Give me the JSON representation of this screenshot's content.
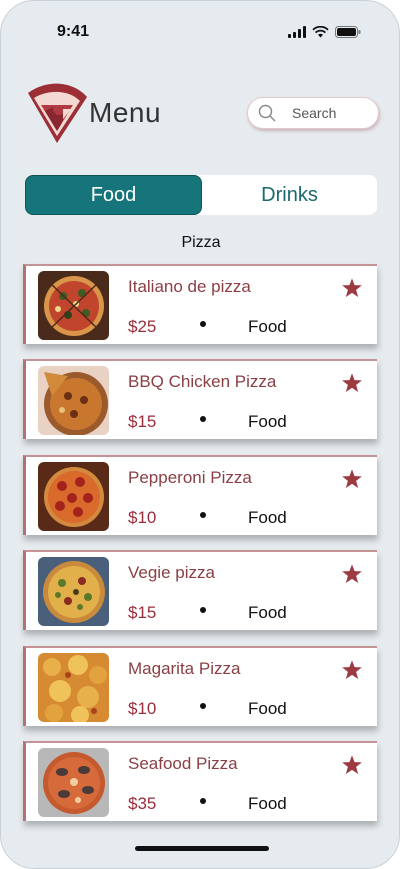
{
  "status_bar": {
    "time": "9:41"
  },
  "header": {
    "title": "Menu"
  },
  "search": {
    "placeholder": "Search"
  },
  "tabs": [
    {
      "label": "Food",
      "active": true
    },
    {
      "label": "Drinks",
      "active": false
    }
  ],
  "section": {
    "title": "Pizza"
  },
  "items": [
    {
      "name": "Italiano de pizza",
      "price": "$25",
      "category": "Food",
      "icon": "star-icon"
    },
    {
      "name": "BBQ Chicken Pizza",
      "price": "$15",
      "category": "Food",
      "icon": "star-icon"
    },
    {
      "name": "Pepperoni Pizza",
      "price": "$10",
      "category": "Food",
      "icon": "star-icon"
    },
    {
      "name": "Vegie pizza",
      "price": "$15",
      "category": "Food",
      "icon": "star-icon"
    },
    {
      "name": "Magarita Pizza",
      "price": "$10",
      "category": "Food",
      "icon": "star-icon"
    },
    {
      "name": "Seafood Pizza",
      "price": "$35",
      "category": "Food",
      "icon": "star-icon"
    }
  ],
  "colors": {
    "accent": "#16757a",
    "brand": "#9b2d3b",
    "star": "#9b3a41",
    "background": "#e6ebef"
  }
}
